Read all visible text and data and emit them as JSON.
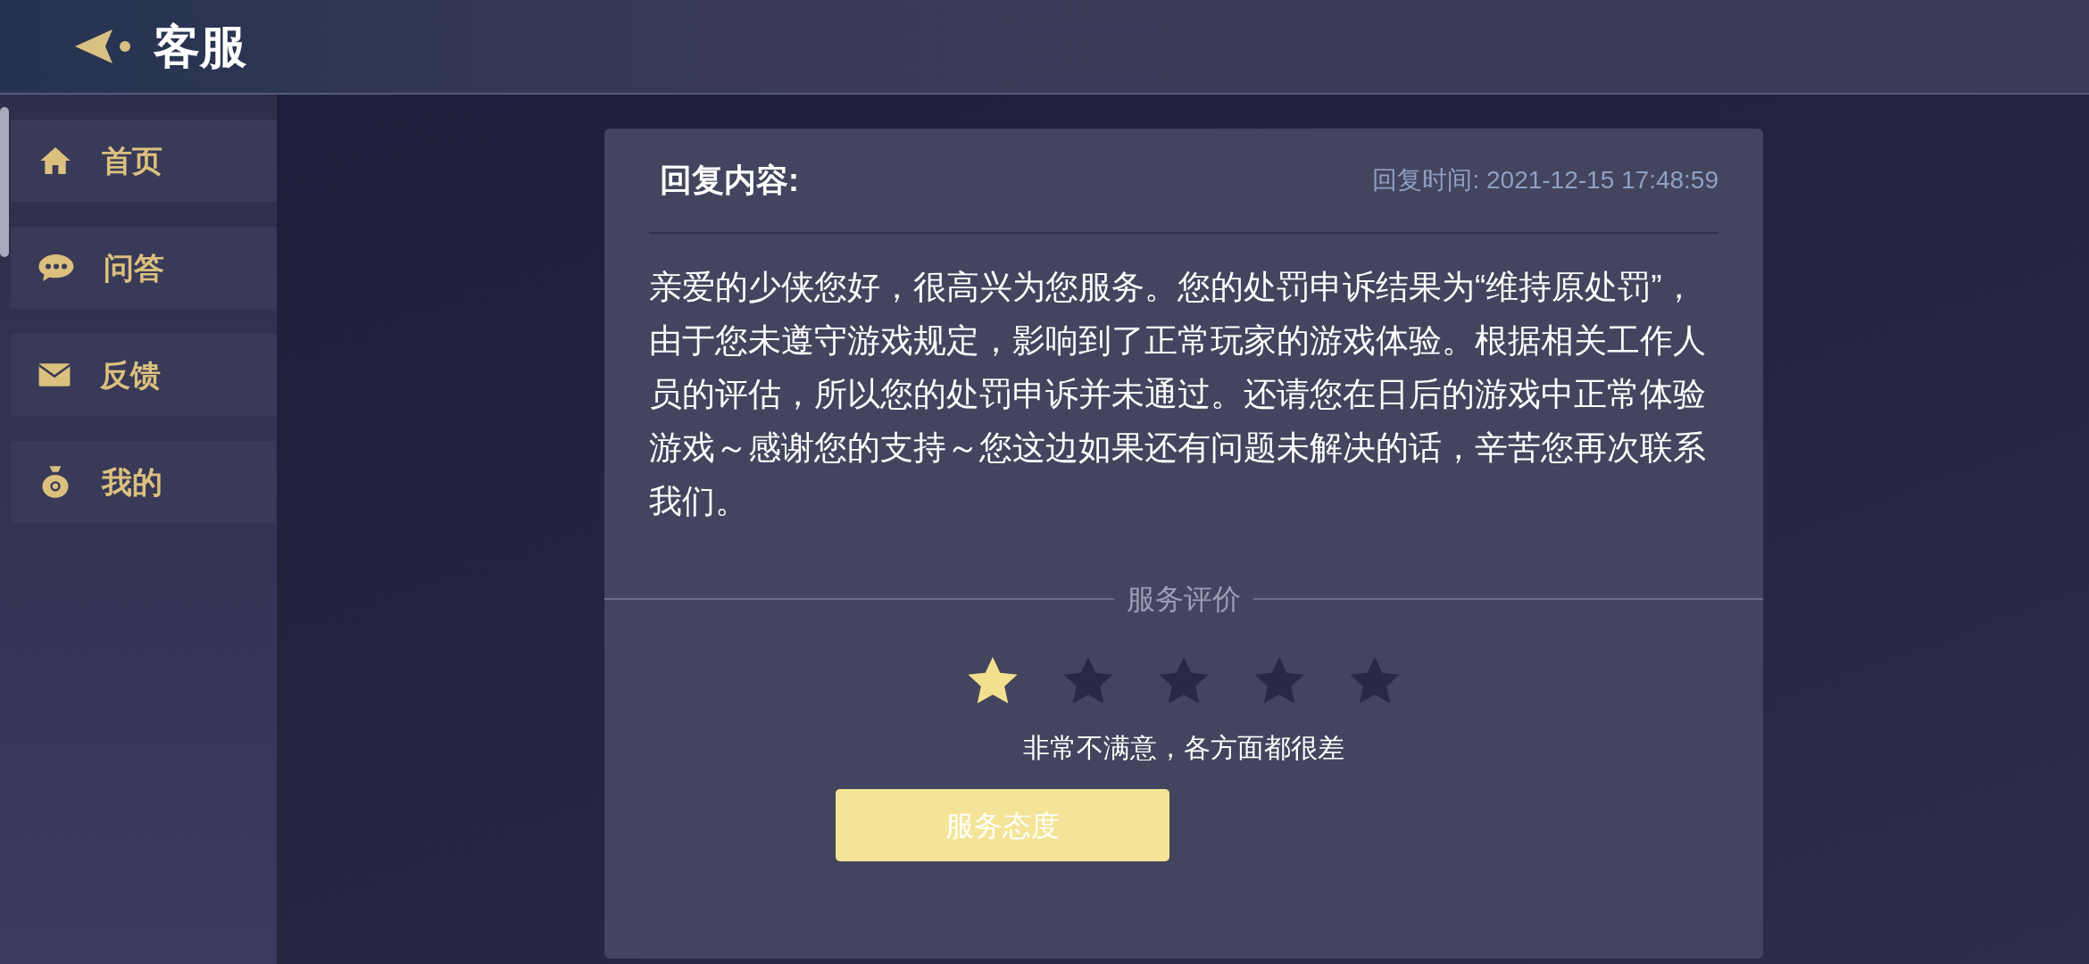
{
  "header": {
    "title": "客服"
  },
  "sidebar": {
    "items": [
      {
        "label": "首页",
        "kind": "home"
      },
      {
        "label": "问答",
        "kind": "chat"
      },
      {
        "label": "反馈",
        "kind": "mail"
      },
      {
        "label": "我的",
        "kind": "bag"
      }
    ]
  },
  "reply": {
    "title": "回复内容:",
    "time": "回复时间: 2021-12-15 17:48:59",
    "body": "亲爱的少侠您好，很高兴为您服务。您的处罚申诉结果为“维持原处罚”，由于您未遵守游戏规定，影响到了正常玩家的游戏体验。根据相关工作人员的评估，所以您的处罚申诉并未通过。还请您在日后的游戏中正常体验游戏～感谢您的支持～您这边如果还有问题未解决的话，辛苦您再次联系我们。"
  },
  "rating": {
    "heading": "服务评价",
    "stars": 1,
    "verdict": "非常不满意，各方面都很差",
    "tag": "服务态度"
  }
}
